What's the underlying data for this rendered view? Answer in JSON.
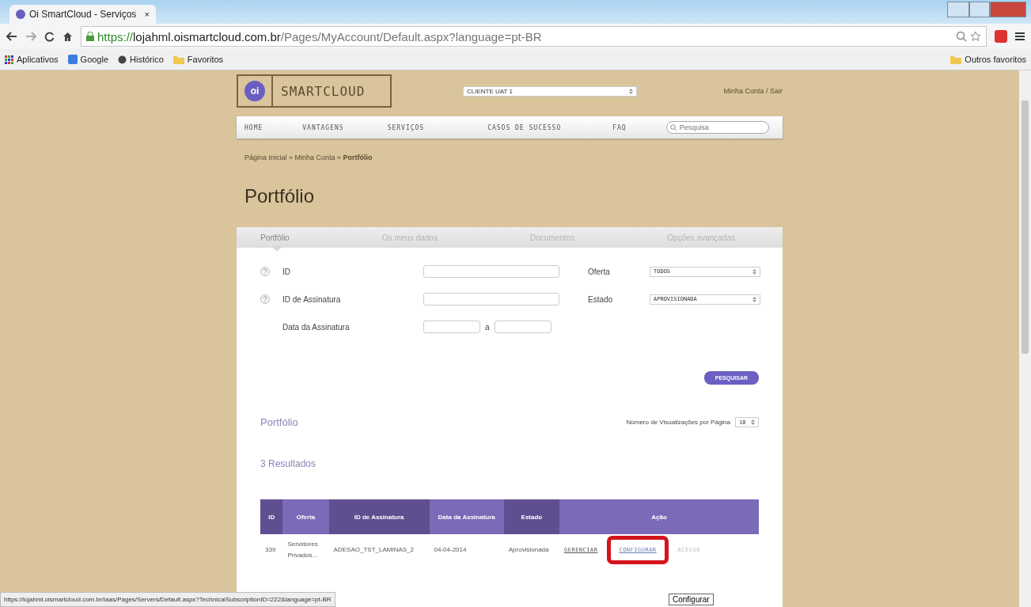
{
  "browser": {
    "tab_title": "Oi SmartCloud - Serviços",
    "tab_close": "×",
    "url_scheme": "https://",
    "url_host": "lojahml.oismartcloud.com.br",
    "url_path": "/Pages/MyAccount/Default.aspx?language=pt-BR",
    "bookmarks": [
      {
        "label": "Aplicativos",
        "kind": "apps"
      },
      {
        "label": "Google",
        "kind": "google"
      },
      {
        "label": "Histórico",
        "kind": "history"
      },
      {
        "label": "Favoritos",
        "kind": "folder"
      }
    ],
    "other_bookmarks": "Outros favoritos"
  },
  "site": {
    "logo_badge": "oi",
    "logo_text": "SMARTCLOUD",
    "client_select": "CLIENTE UAT 1",
    "account_link": "Minha Conta / Sair",
    "nav": [
      "HOME",
      "VANTAGENS",
      "SERVIÇOS",
      "CASOS DE SUCESSO",
      "FAQ"
    ],
    "search": {
      "placeholder": "Pesquisa"
    },
    "breadcrumb": "Página Inicial » Minha Conta » **Portfólio**",
    "heading": "Portfólio"
  },
  "tabs": [
    {
      "label": "Portfólio",
      "selected": true
    },
    {
      "label": "Os meus dados",
      "selected": false
    },
    {
      "label": "Documentos",
      "selected": false
    },
    {
      "label": "Opções avançadas",
      "selected": false
    }
  ],
  "filters": [
    {
      "label": "ID",
      "help": true,
      "kind": "text",
      "side_label": "Oferta",
      "side_value": "TODOS"
    },
    {
      "label": "ID de Assinatura",
      "help": true,
      "kind": "text",
      "side_label": "Estado",
      "side_value": "APROVISIONADA"
    },
    {
      "label": "Data da Assinatura",
      "help": false,
      "kind": "range",
      "range_sep": "a"
    }
  ],
  "search_button": "PESQUISAR",
  "results": {
    "title": "Portfólio",
    "per_page_label": "Número de Visualizações por Página",
    "per_page": "10",
    "count": "3 Resultados"
  },
  "table": {
    "columns": [
      "ID",
      "Oferta",
      "ID de Assinatura",
      "Data da Assinatura",
      "Estado",
      "Ação"
    ],
    "rows": [
      {
        "cells": [
          "339",
          "Servidores Privados...",
          "ADESAO_TST_LAMINAS_2",
          "04-04-2014",
          "Aprovisionada"
        ],
        "actions": [
          {
            "label": "GERENCIAR",
            "disabled": false,
            "highlighted": false
          },
          {
            "label": "CONFIGURAR",
            "disabled": false,
            "highlighted": true
          },
          {
            "label": "ACESSO",
            "disabled": true,
            "highlighted": false
          }
        ]
      }
    ]
  },
  "status_bar": "https://lojahml.oismartcloud.com.br/Iaas/Pages/Servers/Default.aspx?TechnicalSubscriptionID=222&language=pt-BR",
  "tooltip": "Configurar"
}
